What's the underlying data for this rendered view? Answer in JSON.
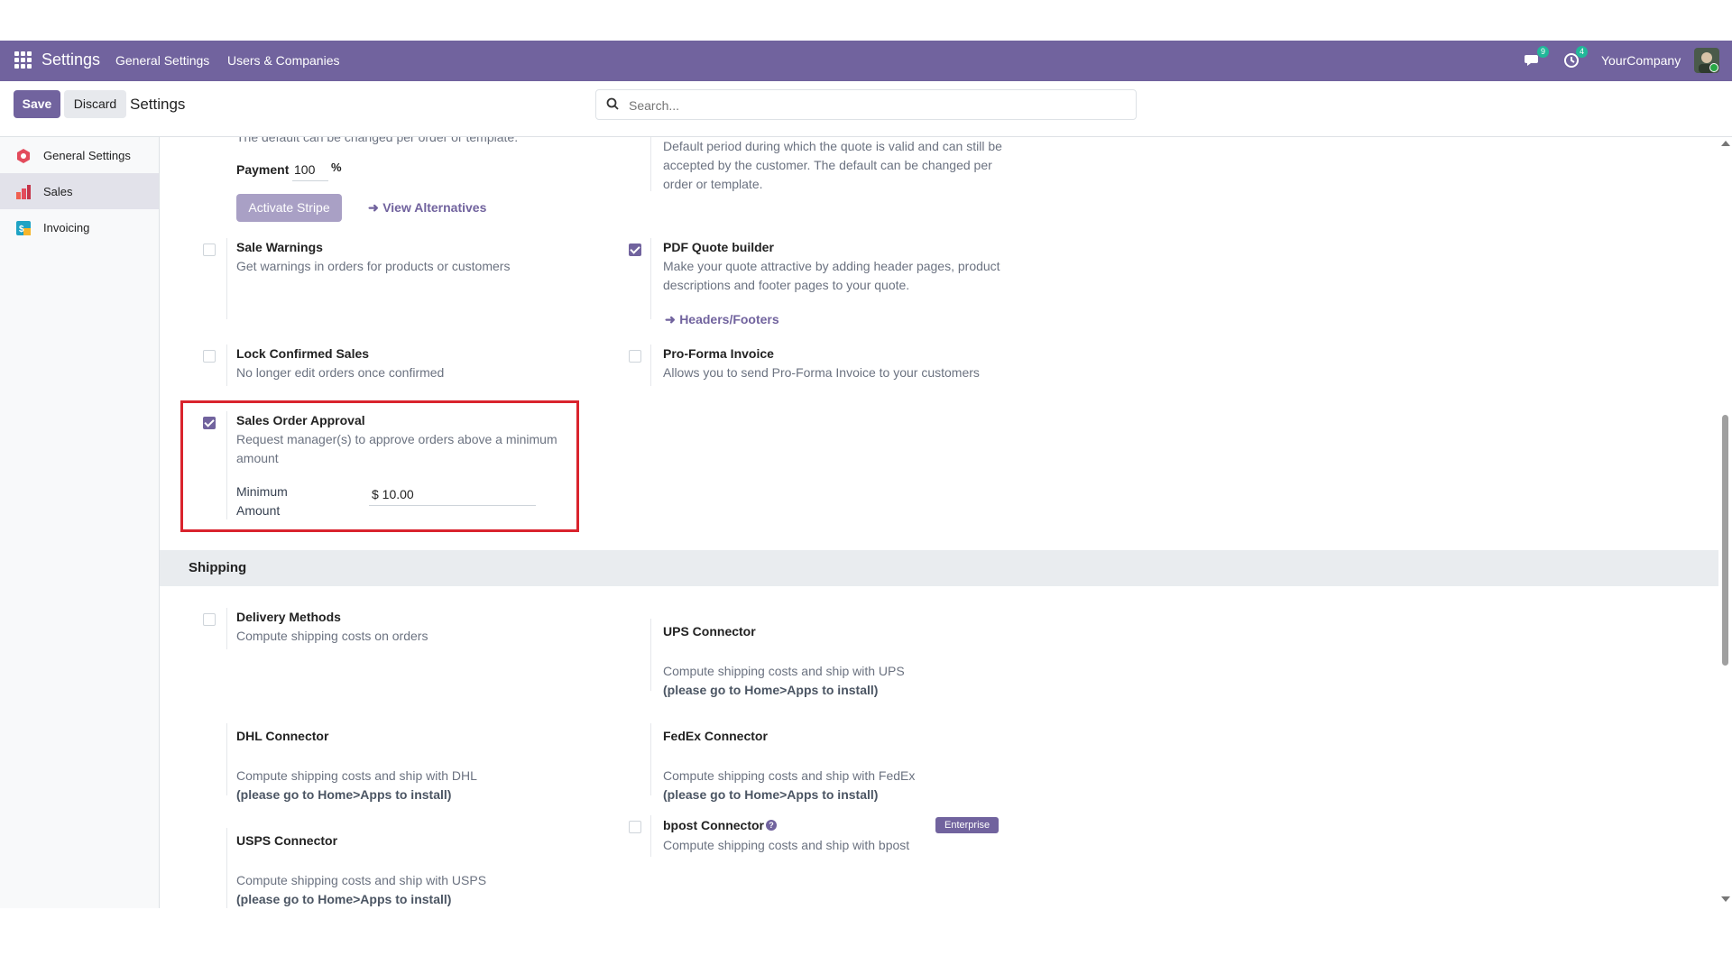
{
  "topbar": {
    "app_title": "Settings",
    "nav": [
      "General Settings",
      "Users & Companies"
    ],
    "messages_badge": "9",
    "activities_badge": "4",
    "company": "YourCompany"
  },
  "controlbar": {
    "save_label": "Save",
    "discard_label": "Discard",
    "title": "Settings",
    "search_placeholder": "Search..."
  },
  "sidebar": {
    "items": [
      {
        "label": "General Settings"
      },
      {
        "label": "Sales"
      },
      {
        "label": "Invoicing"
      }
    ]
  },
  "content": {
    "top_left_cut_text": "The default can be changed per order or template.",
    "payment_label": "Payment",
    "payment_value": "100",
    "payment_unit": "%",
    "activate_stripe_label": "Activate Stripe",
    "view_alternatives_label": "View Alternatives",
    "quote_validity_desc": "Default period during which the quote is valid and can still be accepted by the customer. The default can be changed per order or template.",
    "settings": {
      "sale_warnings": {
        "title": "Sale Warnings",
        "desc": "Get warnings in orders for products or customers",
        "checked": false
      },
      "pdf_quote_builder": {
        "title": "PDF Quote builder",
        "desc": "Make your quote attractive by adding header pages, product descriptions and footer pages to your quote.",
        "link": "Headers/Footers",
        "checked": true
      },
      "lock_confirmed_sales": {
        "title": "Lock Confirmed Sales",
        "desc": "No longer edit orders once confirmed",
        "checked": false
      },
      "pro_forma_invoice": {
        "title": "Pro-Forma Invoice",
        "desc": "Allows you to send Pro-Forma Invoice to your customers",
        "checked": false
      },
      "sales_order_approval": {
        "title": "Sales Order Approval",
        "desc": "Request manager(s) to approve orders above a minimum amount",
        "min_amount_label": "Minimum Amount",
        "min_amount_value": "$ 10.00",
        "checked": true
      }
    },
    "shipping": {
      "header": "Shipping",
      "delivery_methods": {
        "title": "Delivery Methods",
        "desc": "Compute shipping costs on orders",
        "checked": false
      },
      "ups": {
        "title": "UPS Connector",
        "desc": "Compute shipping costs and ship with UPS",
        "note": "(please go to Home>Apps to install)"
      },
      "dhl": {
        "title": "DHL Connector",
        "desc": "Compute shipping costs and ship with DHL",
        "note": "(please go to Home>Apps to install)"
      },
      "fedex": {
        "title": "FedEx Connector",
        "desc": "Compute shipping costs and ship with FedEx",
        "note": "(please go to Home>Apps to install)"
      },
      "usps": {
        "title": "USPS Connector",
        "desc": "Compute shipping costs and ship with USPS",
        "note": "(please go to Home>Apps to install)"
      },
      "bpost": {
        "title": "bpost Connector",
        "desc": "Compute shipping costs and ship with bpost",
        "badge": "Enterprise",
        "help": "?",
        "checked": false
      }
    }
  },
  "colors": {
    "brand": "#71639e",
    "highlight": "#d9232d"
  }
}
